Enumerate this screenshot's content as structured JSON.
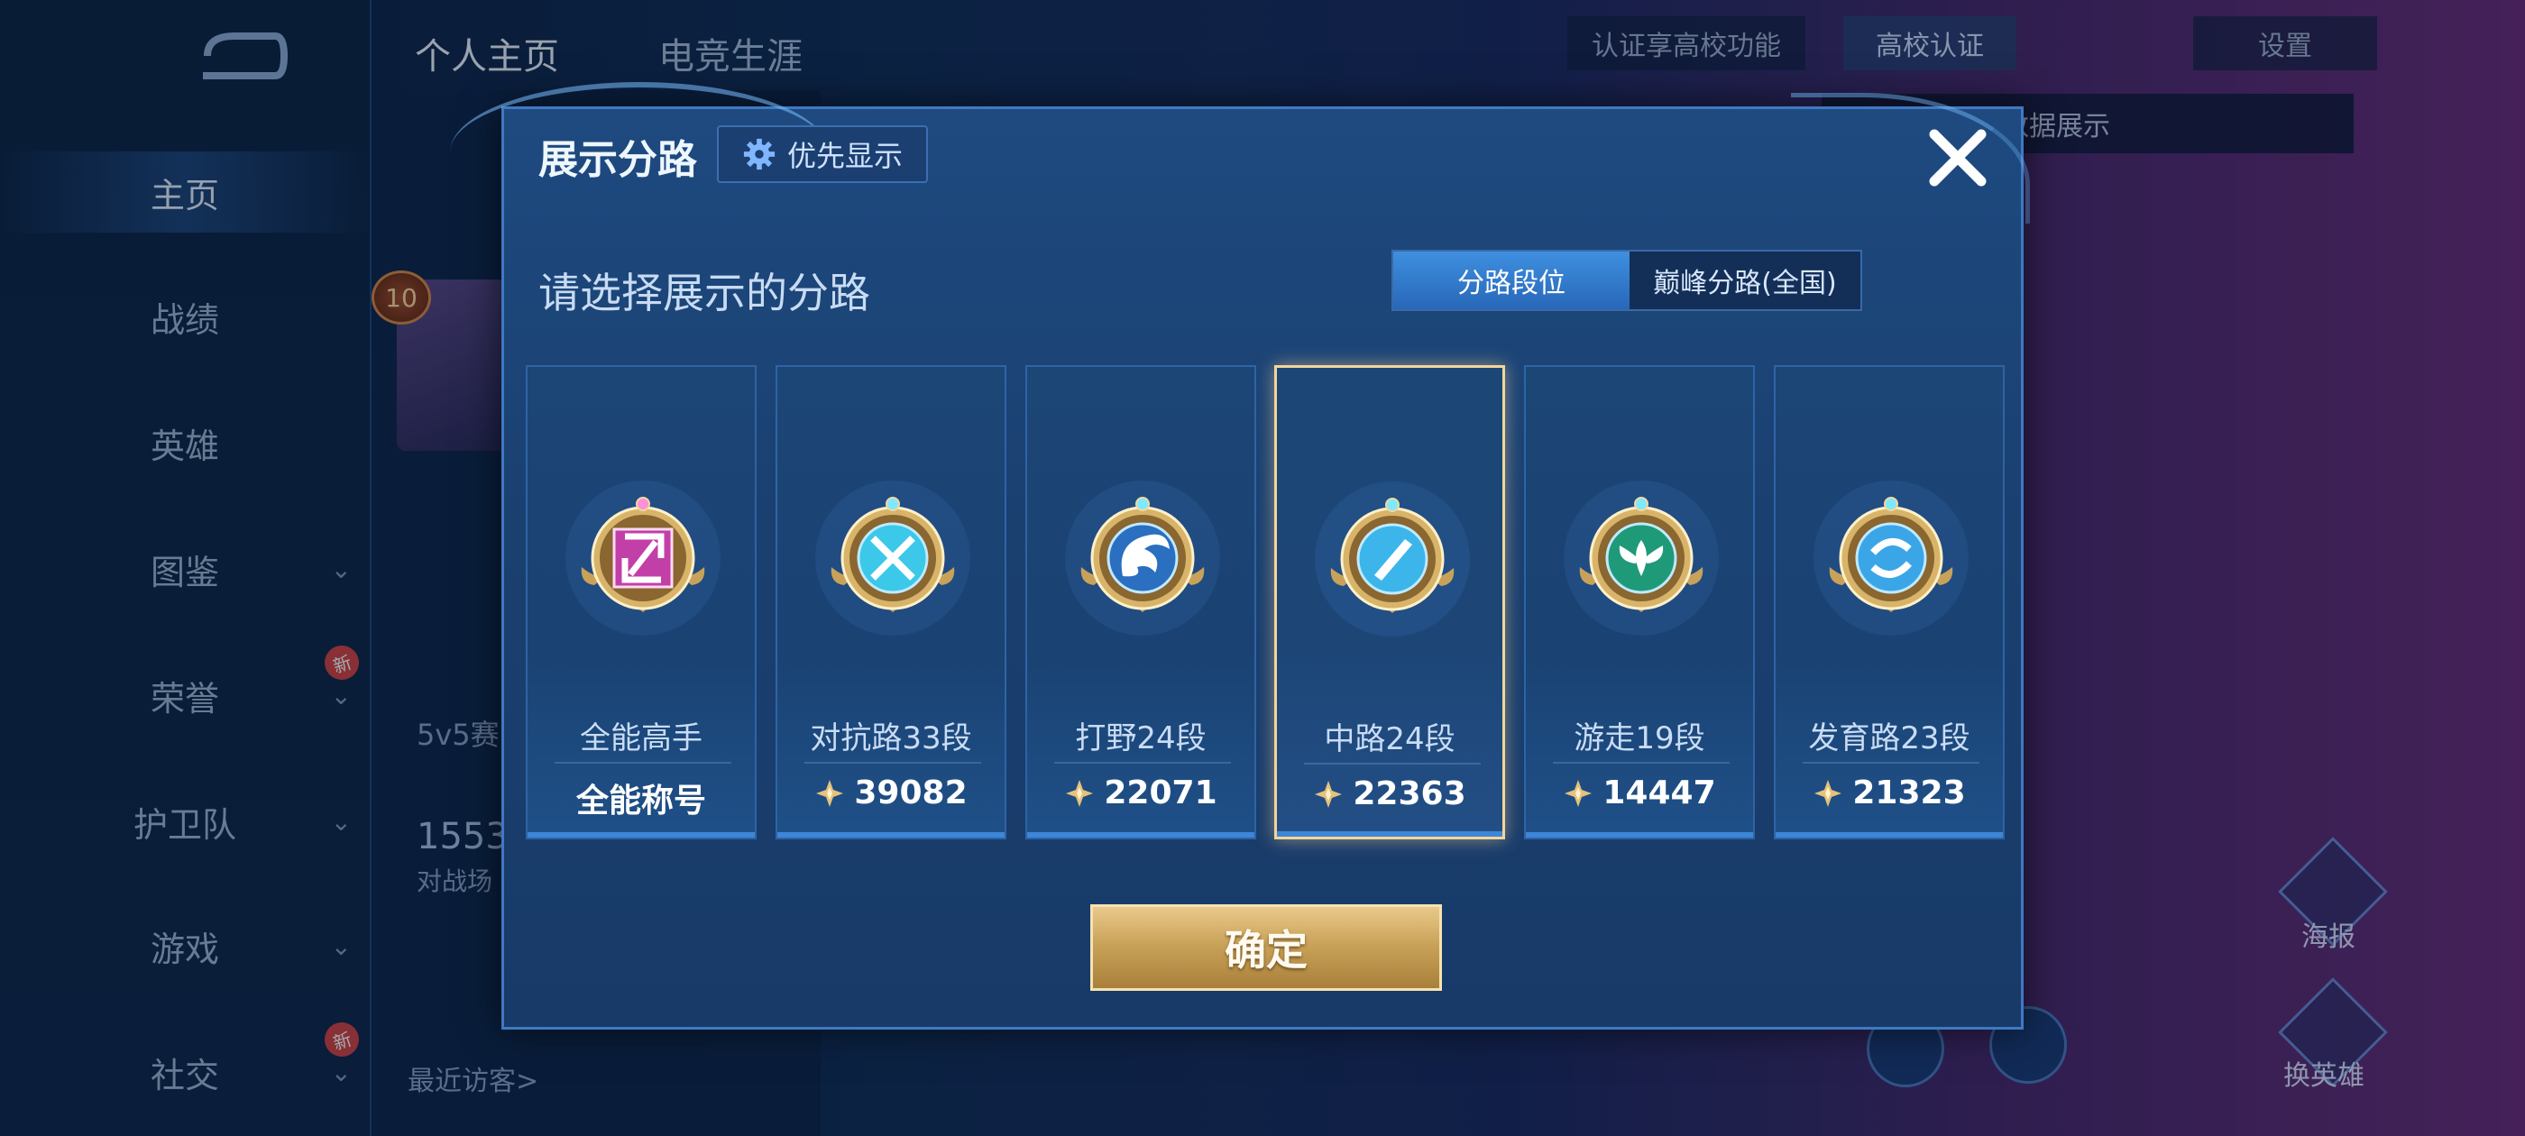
{
  "background": {
    "nav": [
      {
        "label": "主页",
        "active": true,
        "chevron": false,
        "new": false
      },
      {
        "label": "战绩",
        "active": false,
        "chevron": false,
        "new": false
      },
      {
        "label": "英雄",
        "active": false,
        "chevron": false,
        "new": false
      },
      {
        "label": "图鉴",
        "active": false,
        "chevron": true,
        "new": false
      },
      {
        "label": "荣誉",
        "active": false,
        "chevron": true,
        "new": true
      },
      {
        "label": "护卫队",
        "active": false,
        "chevron": true,
        "new": false
      },
      {
        "label": "游戏",
        "active": false,
        "chevron": true,
        "new": false
      },
      {
        "label": "社交",
        "active": false,
        "chevron": true,
        "new": true
      }
    ],
    "new_badge": "新",
    "top_tabs": [
      {
        "label": "个人主页",
        "active": true
      },
      {
        "label": "电竞生涯",
        "active": false
      }
    ],
    "level": "10",
    "mode_text": "5v5赛",
    "number_text": "1553",
    "battle_text": "对战场",
    "recent_visitors": "最近访客>",
    "cert_text": "认证享高校功能",
    "school_cert": "高校认证",
    "settings": "设置",
    "tip_text": "以切换灵宝和数据展示",
    "poster": "海报",
    "change_hero": "换英雄"
  },
  "dialog": {
    "title": "展示分路",
    "priority_label": "优先显示",
    "subtitle": "请选择展示的分路",
    "segments": [
      {
        "label": "分路段位",
        "active": true
      },
      {
        "label": "巅峰分路(全国)",
        "active": false
      }
    ],
    "cards": [
      {
        "name": "全能高手",
        "score": "全能称号",
        "badge": "allround",
        "color": "#c23fa8",
        "has_score_icon": false,
        "selected": false
      },
      {
        "name": "对抗路33段",
        "score": "39082",
        "badge": "clash",
        "color": "#3cc8e8",
        "has_score_icon": true,
        "selected": false
      },
      {
        "name": "打野24段",
        "score": "22071",
        "badge": "jungle",
        "color": "#2a6fc0",
        "has_score_icon": true,
        "selected": false
      },
      {
        "name": "中路24段",
        "score": "22363",
        "badge": "mid",
        "color": "#3cb6ea",
        "has_score_icon": true,
        "selected": true
      },
      {
        "name": "游走19段",
        "score": "14447",
        "badge": "roam",
        "color": "#1f9a78",
        "has_score_icon": true,
        "selected": false
      },
      {
        "name": "发育路23段",
        "score": "21323",
        "badge": "farm",
        "color": "#3aa6e8",
        "has_score_icon": true,
        "selected": false
      }
    ],
    "confirm_label": "确定"
  }
}
